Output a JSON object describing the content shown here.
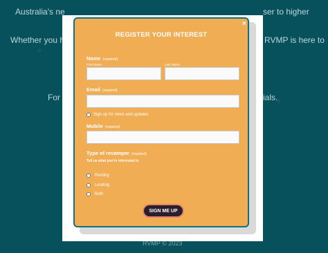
{
  "background": {
    "line1_left": "Australia's ne",
    "line1_right": "ser to higher",
    "line2_left": "Whether you h",
    "line2_right": "RVMP is here to",
    "line3_left": "For",
    "line3_right": "ials.",
    "footer": "RVMP © 2023"
  },
  "modal": {
    "close_label": "×",
    "title": "REGISTER YOUR INTEREST",
    "name_label": "Name",
    "required_text": "(required)",
    "first_name_label": "First Name",
    "last_name_label": "Last Name",
    "first_name_value": "",
    "last_name_value": "",
    "email_label": "Email",
    "email_value": "",
    "newsletter_label": "Sign up for news and updates",
    "mobile_label": "Mobile",
    "mobile_value": "",
    "type_label": "Type of revamper",
    "type_hint": "Tell us what you're interested in",
    "options": [
      "Renting",
      "Lending",
      "Both"
    ],
    "submit_label": "SIGN ME UP"
  },
  "colors": {
    "background": "#07515c",
    "modal": "#f0ad54",
    "modal_border": "#11707a",
    "button": "#2a1f2a",
    "button_border": "#e8836b"
  }
}
